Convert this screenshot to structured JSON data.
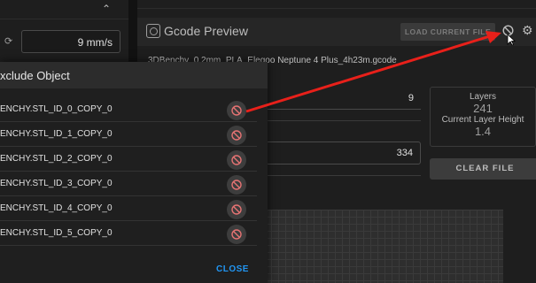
{
  "left_panel": {
    "speed_value": "9 mm/s"
  },
  "gcode_preview": {
    "title": "Gcode Preview",
    "load_button": "LOAD CURRENT FILE",
    "filename": "3DBenchy_0.2mm_PLA_Elegoo Neptune 4 Plus_4h23m.gcode",
    "field_value_1": "9",
    "field_value_2": "334",
    "layers_label": "Layers",
    "layers_value": "241",
    "current_layer_label": "Current Layer Height",
    "current_layer_value": "1.4",
    "clear_button": "CLEAR FILE"
  },
  "dialog": {
    "title": "xclude Object",
    "objects": [
      "ENCHY.STL_ID_0_COPY_0",
      "ENCHY.STL_ID_1_COPY_0",
      "ENCHY.STL_ID_2_COPY_0",
      "ENCHY.STL_ID_3_COPY_0",
      "ENCHY.STL_ID_4_COPY_0",
      "ENCHY.STL_ID_5_COPY_0"
    ],
    "close_button": "CLOSE"
  },
  "icons": {
    "chevron": "chevron-up-icon",
    "refresh": "refresh-icon",
    "exclude": "no-entry-icon",
    "cancel": "cancel-icon",
    "settings": "gear-icon"
  },
  "colors": {
    "accent": "#2196f3",
    "exclude_icon": "#e57373",
    "annotation_arrow": "#e8201a"
  }
}
